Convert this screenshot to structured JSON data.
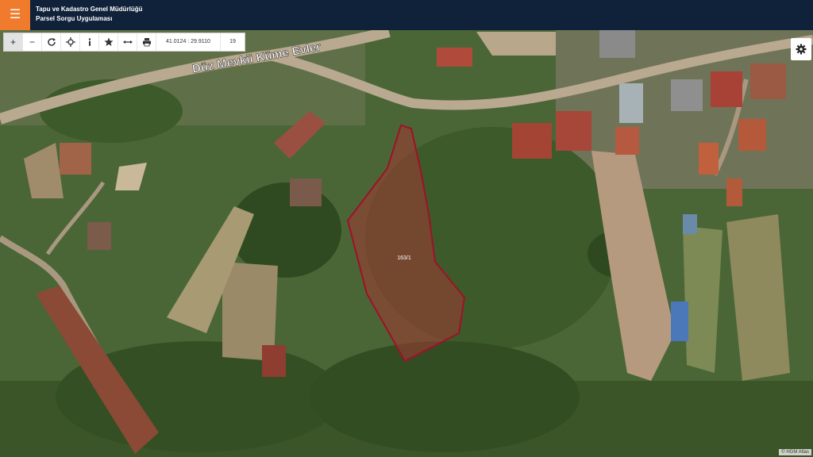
{
  "header": {
    "title_line1": "Tapu ve Kadastro Genel Müdürlüğü",
    "title_line2": "Parsel Sorgu Uygulaması",
    "menu_icon": "hamburger-menu-icon",
    "bg_color": "#10213a",
    "accent_color": "#f07b2c"
  },
  "toolbar": {
    "zoom_in": "+",
    "zoom_out": "−",
    "coordinates": "41.0124 : 29.9110",
    "zoom_level": "19",
    "icons": [
      "zoom-in-icon",
      "zoom-out-icon",
      "refresh-icon",
      "locate-icon",
      "info-icon",
      "favorite-star-icon",
      "measure-icon",
      "print-icon"
    ]
  },
  "map": {
    "street_label": "Düz Mevkii Küme Evler",
    "parcel_label": "163/1",
    "parcel_color": "#a0102a",
    "attribution": "© HGM Atlas"
  },
  "settings_icon": "gear-icon"
}
